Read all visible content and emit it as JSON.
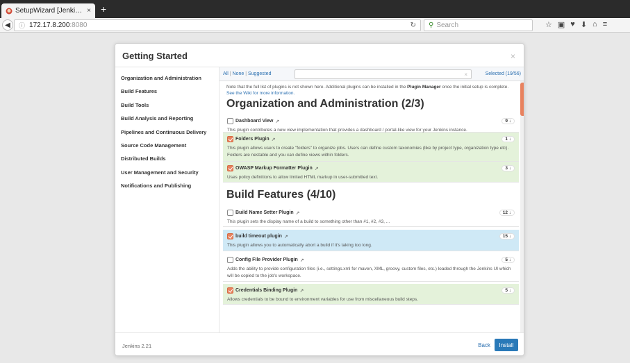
{
  "browser": {
    "tab_title": "SetupWizard [Jenki…",
    "tab_close": "×",
    "new_tab": "+",
    "url_host": "172.17.8.200",
    "url_port": ":8080",
    "search_placeholder": "Search"
  },
  "dialog": {
    "title": "Getting Started",
    "close": "×",
    "sidebar": [
      "Organization and Administration",
      "Build Features",
      "Build Tools",
      "Build Analysis and Reporting",
      "Pipelines and Continuous Delivery",
      "Source Code Management",
      "Distributed Builds",
      "User Management and Security",
      "Notifications and Publishing"
    ],
    "filters": {
      "all": "All",
      "none": "None",
      "suggested": "Suggested",
      "sep": "|"
    },
    "selected": "Selected (19/56)",
    "note_text": "Note that the full list of plugins is not shown here. Additional plugins can be installed in the ",
    "note_bold": "Plugin Manager",
    "note_text2": " once the initial setup is complete. ",
    "note_link": "See the Wiki for more information.",
    "categories": [
      {
        "title": "Organization and Administration (2/3)"
      },
      {
        "title": "Build Features (4/10)"
      }
    ],
    "plugins": [
      {
        "name": "Dashboard View",
        "link": "↗",
        "count": "9 ↓",
        "checked": false,
        "desc": "This plugin contributes a new view implementation that provides a dashboard / portal-like view for your Jenkins instance."
      },
      {
        "name": "Folders Plugin",
        "link": "↗",
        "count": "1 ↓",
        "checked": true,
        "desc": "This plugin allows users to create \"folders\" to organize jobs. Users can define custom taxonomies (like by project type, organization type etc). Folders are nestable and you can define views within folders."
      },
      {
        "name": "OWASP Markup Formatter Plugin",
        "link": "↗",
        "count": "3 ↓",
        "checked": true,
        "desc": "Uses policy definitions to allow limited HTML markup in user-submitted text."
      },
      {
        "name": "Build Name Setter Plugin",
        "link": "↗",
        "count": "12 ↓",
        "checked": false,
        "desc": "This plugin sets the display name of a build to something other than #1, #2, #3, ..."
      },
      {
        "name": "build timeout plugin",
        "link": "↗",
        "count": "15 ↓",
        "checked": true,
        "desc": "This plugin allows you to automatically abort a build if it's taking too long."
      },
      {
        "name": "Config File Provider Plugin",
        "link": "↗",
        "count": "5 ↓",
        "checked": false,
        "desc": "Adds the ability to provide configuration files (i.e., settings.xml for maven, XML, groovy, custom files, etc.) loaded through the Jenkins UI which will be copied to the job's workspace."
      },
      {
        "name": "Credentials Binding Plugin",
        "link": "↗",
        "count": "5 ↓",
        "checked": true,
        "desc": "Allows credentials to be bound to environment variables for use from miscellaneous build steps."
      }
    ],
    "footer": {
      "version": "Jenkins 2.21",
      "back": "Back",
      "install": "Install"
    }
  }
}
